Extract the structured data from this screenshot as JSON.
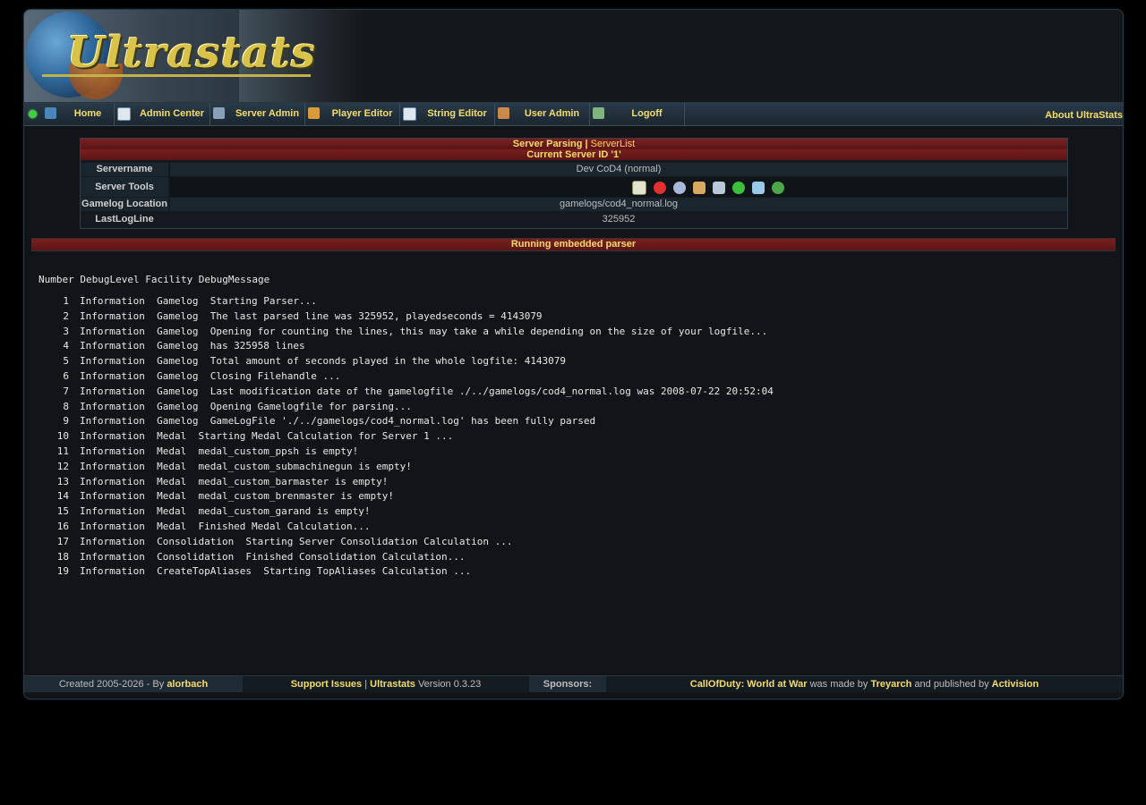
{
  "banner": {
    "logo_text": "Ultrastats"
  },
  "nav": {
    "items": [
      {
        "label": "Home"
      },
      {
        "label": "Admin Center"
      },
      {
        "label": "Server Admin"
      },
      {
        "label": "Player Editor"
      },
      {
        "label": "String Editor"
      },
      {
        "label": "User Admin"
      },
      {
        "label": "Logoff"
      }
    ],
    "about": "About UltraStats"
  },
  "server_box": {
    "title_prefix": "Server Parsing |",
    "title_link": "ServerList",
    "subtitle": "Current Server ID '1'",
    "rows": [
      {
        "key": "Servername",
        "value": "Dev CoD4 (normal)"
      },
      {
        "key": "Server Tools",
        "value": ""
      },
      {
        "key": "Gamelog Location",
        "value": "gamelogs/cod4_normal.log"
      },
      {
        "key": "LastLogLine",
        "value": "325952"
      }
    ],
    "tool_icons": [
      "edit-icon",
      "delete-icon",
      "settings-icon",
      "users-icon",
      "stats-icon",
      "refresh-icon",
      "recycle-icon",
      "download-icon"
    ]
  },
  "running_title": "Running embedded parser",
  "log": {
    "header": "Number DebugLevel Facility DebugMessage",
    "rows": [
      {
        "n": "1",
        "text": "Information  Gamelog  Starting Parser..."
      },
      {
        "n": "2",
        "text": "Information  Gamelog  The last parsed line was 325952, playedseconds = 4143079"
      },
      {
        "n": "3",
        "text": "Information  Gamelog  Opening for counting the lines, this may take a while depending on the size of your logfile..."
      },
      {
        "n": "4",
        "text": "Information  Gamelog  has 325958 lines"
      },
      {
        "n": "5",
        "text": "Information  Gamelog  Total amount of seconds played in the whole logfile: 4143079"
      },
      {
        "n": "6",
        "text": "Information  Gamelog  Closing Filehandle ..."
      },
      {
        "n": "7",
        "text": "Information  Gamelog  Last modification date of the gamelogfile ./../gamelogs/cod4_normal.log was 2008-07-22 20:52:04"
      },
      {
        "n": "8",
        "text": "Information  Gamelog  Opening Gamelogfile for parsing..."
      },
      {
        "n": "9",
        "text": "Information  Gamelog  GameLogFile './../gamelogs/cod4_normal.log' has been fully parsed"
      },
      {
        "n": "10",
        "text": "Information  Medal  Starting Medal Calculation for Server 1 ..."
      },
      {
        "n": "11",
        "text": "Information  Medal  medal_custom_ppsh is empty!"
      },
      {
        "n": "12",
        "text": "Information  Medal  medal_custom_submachinegun is empty!"
      },
      {
        "n": "13",
        "text": "Information  Medal  medal_custom_barmaster is empty!"
      },
      {
        "n": "14",
        "text": "Information  Medal  medal_custom_brenmaster is empty!"
      },
      {
        "n": "15",
        "text": "Information  Medal  medal_custom_garand is empty!"
      },
      {
        "n": "16",
        "text": "Information  Medal  Finished Medal Calculation..."
      },
      {
        "n": "17",
        "text": "Information  Consolidation  Starting Server Consolidation Calculation ..."
      },
      {
        "n": "18",
        "text": "Information  Consolidation  Finished Consolidation Calculation..."
      },
      {
        "n": "19",
        "text": "Information  CreateTopAliases  Starting TopAliases Calculation ..."
      }
    ]
  },
  "footer": {
    "created_prefix": "Created 2005-2026 - By",
    "author": "alorbach",
    "support": "Support Issues",
    "sep": "|",
    "product": "Ultrastats",
    "version": "Version 0.3.23",
    "sponsors": "Sponsors:",
    "game": "CallOfDuty: World at War",
    "made_by": "was made by",
    "dev": "Treyarch",
    "published_by": "and published by",
    "publisher": "Activision"
  },
  "colors": {
    "accent": "#f5dc6a",
    "header_red": "#6a1a1a",
    "background": "#121417"
  }
}
